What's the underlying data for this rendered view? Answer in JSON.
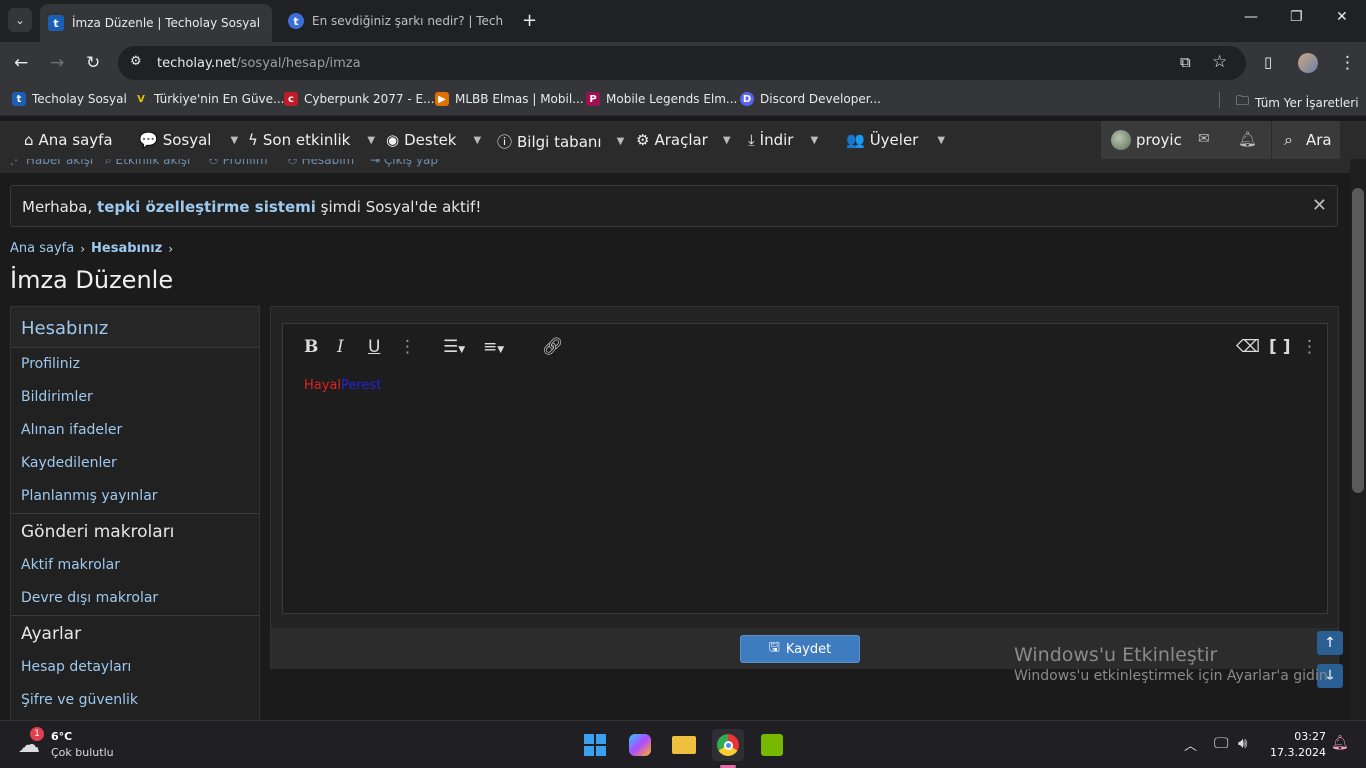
{
  "browser": {
    "tabs": [
      {
        "title": "İmza Düzenle | Techolay Sosyal",
        "favicon": "t",
        "active": true
      },
      {
        "title": "En sevdiğiniz şarkı nedir? | Tech",
        "favicon": "t",
        "active": false
      }
    ],
    "url_host": "techolay.net",
    "url_path": "/sosyal/hesap/imza",
    "bookmarks": [
      {
        "label": "Techolay Sosyal",
        "icon": "t",
        "color": "#1a5fb4"
      },
      {
        "label": "Türkiye'nin En Güve...",
        "icon": "V",
        "color": "#b8a000"
      },
      {
        "label": "Cyberpunk 2077 - E...",
        "icon": "c",
        "color": "#c01c28"
      },
      {
        "label": "MLBB Elmas | Mobil...",
        "icon": "▶",
        "color": "#e07000"
      },
      {
        "label": "Mobile Legends Elm...",
        "icon": "P",
        "color": "#a01050"
      },
      {
        "label": "Discord Developer...",
        "icon": "D",
        "color": "#5865f2"
      }
    ],
    "bookmarks_all": "Tüm Yer İşaretleri"
  },
  "site_nav": {
    "items": [
      {
        "label": "Ana sayfa",
        "icon": "home-icon",
        "caret": false
      },
      {
        "label": "Sosyal",
        "icon": "chat-icon",
        "caret": true
      },
      {
        "label": "Son etkinlik",
        "icon": "bolt-icon",
        "caret": true
      },
      {
        "label": "Destek",
        "icon": "support-icon",
        "caret": true
      },
      {
        "label": "Bilgi tabanı",
        "icon": "info-icon",
        "caret": true
      },
      {
        "label": "Araçlar",
        "icon": "gear-icon",
        "caret": true
      },
      {
        "label": "İndir",
        "icon": "download-icon",
        "caret": true
      },
      {
        "label": "Üyeler",
        "icon": "users-icon",
        "caret": true
      }
    ],
    "username": "proyic",
    "search_label": "Ara"
  },
  "sub_nav": [
    "Haber akışı",
    "Etkinlik akışı",
    "Profilim",
    "Hesabım",
    "Çıkış yap"
  ],
  "notice": {
    "prefix": "Merhaba, ",
    "bold": "tepki özelleştirme sistemi",
    "suffix": " şimdi Sosyal'de aktif!"
  },
  "breadcrumb": {
    "home": "Ana sayfa",
    "current": "Hesabınız"
  },
  "page_title": "İmza Düzenle",
  "sidebar": {
    "header": "Hesabınız",
    "group1": [
      "Profiliniz",
      "Bildirimler",
      "Alınan ifadeler",
      "Kaydedilenler",
      "Planlanmış yayınlar"
    ],
    "section2": "Gönderi makroları",
    "group2": [
      "Aktif makrolar",
      "Devre dışı makrolar"
    ],
    "section3": "Ayarlar",
    "group3": [
      "Hesap detayları",
      "Şifre ve güvenlik"
    ]
  },
  "editor": {
    "text_red": "Hayal",
    "text_blue": "Perest"
  },
  "save_label": "Kaydet",
  "watermark": {
    "title": "Windows'u Etkinleştir",
    "subtitle": "Windows'u etkinleştirmek için Ayarlar'a gidin."
  },
  "taskbar": {
    "weather_temp": "6°C",
    "weather_desc": "Çok bulutlu",
    "weather_badge": "1",
    "time": "03:27",
    "date": "17.3.2024"
  }
}
